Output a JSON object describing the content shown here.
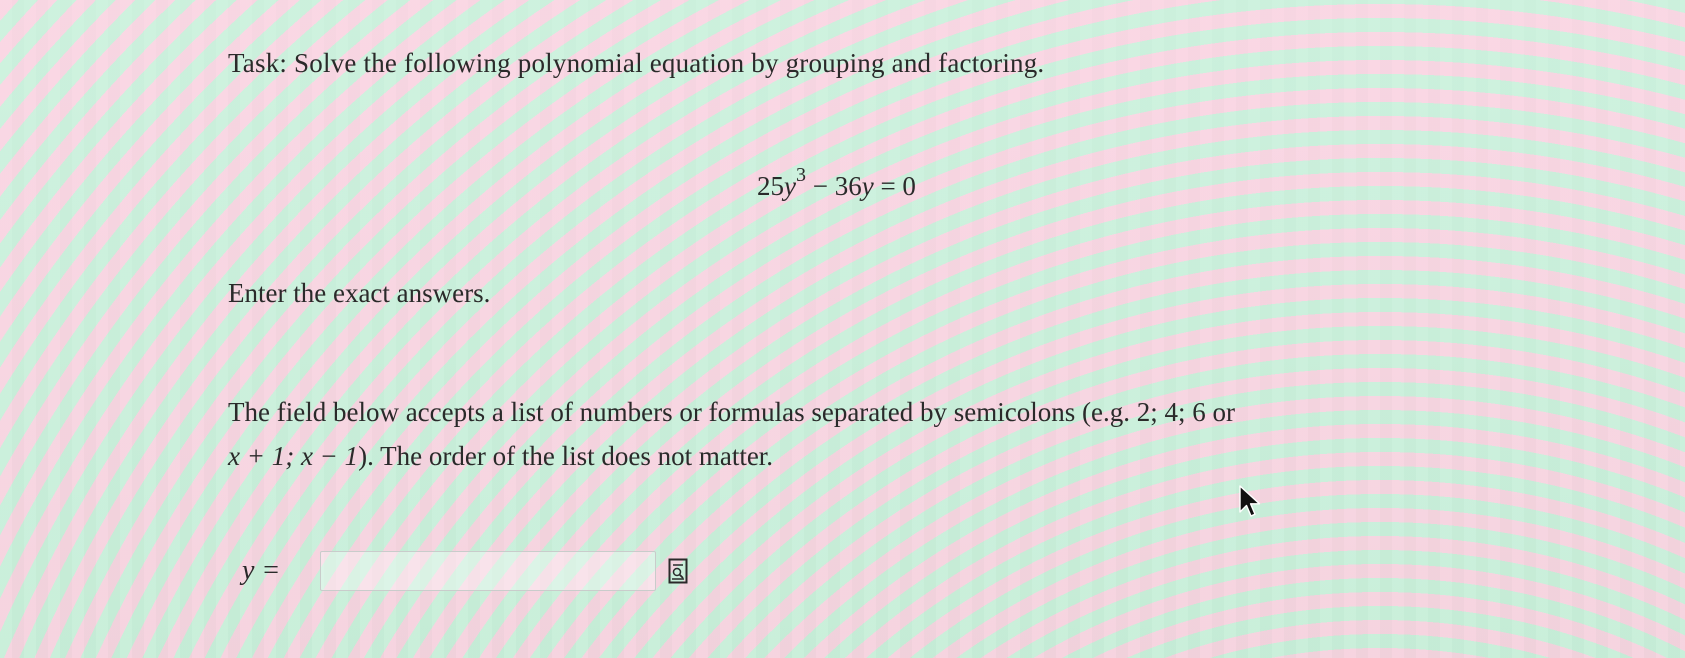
{
  "task": {
    "text": "Task:  Solve the following polynomial equation by grouping and factoring."
  },
  "equation": {
    "coef1": "25",
    "var1": "y",
    "exp1": "3",
    "op": " − 36",
    "var2": "y",
    "rhs": " = 0"
  },
  "instruction": {
    "text": "Enter the exact answers."
  },
  "description": {
    "line1": "The field below accepts a list of numbers or formulas separated by semicolons (e.g. 2; 4; 6 or",
    "example_math": "x + 1;  x − 1",
    "line2_rest": "). The order of the list does not matter."
  },
  "answer": {
    "label": "y =",
    "value": "",
    "placeholder": ""
  },
  "icons": {
    "preview": "preview-icon",
    "cursor": "mouse-pointer-icon"
  }
}
